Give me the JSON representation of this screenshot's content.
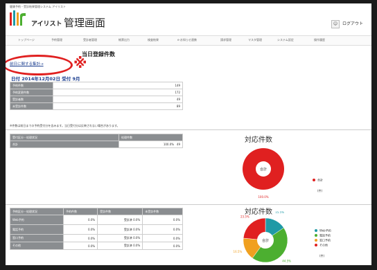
{
  "header": {
    "top_label": "健康予約・受診結果管理システム アイリスト",
    "brand": "アイリスト",
    "page_title": "管理画面",
    "user_icon": "person-icon",
    "logout_label": "ログアウト"
  },
  "nav": {
    "items": [
      "トップページ",
      "予約管理",
      "受診者管理",
      "帳票出力",
      "検査結果",
      "e-お知らせ連携",
      "請求管理",
      "マスタ管理",
      "システム設定",
      "操作履歴"
    ]
  },
  "today": {
    "title": "当日登録件数",
    "link": "前日に関する集計→",
    "mark": "※",
    "date": "日付 2014年12月02日 受付 9月"
  },
  "summary_table": {
    "rows": [
      {
        "label": "予約件数",
        "value": "149"
      },
      {
        "label": "予約変更件数",
        "value": "172"
      },
      {
        "label": "受診者数",
        "value": "49"
      },
      {
        "label": "未受診件数",
        "value": "89"
      }
    ]
  },
  "note": "※件数は前日までの予約受付分を含みます。当日受付分は反映されない場合があります。",
  "mid_table": {
    "headers": [
      "受付区分・処理状況",
      "処理件数"
    ],
    "row": {
      "label": "合計",
      "value": "100.0%",
      "count": "49"
    }
  },
  "bottom_table": {
    "headers": [
      "予約区分・処理状況",
      "予約件数",
      "受診件数",
      "未受診件数"
    ],
    "rows": [
      {
        "label": "Web予約",
        "c1": "Web予約",
        "c2": "0.0%",
        "c3": "受診済 0.0%",
        "c4": "0.0%"
      },
      {
        "label": "電話予約",
        "c1": "電話予約",
        "c2": "0.0%",
        "c3": "受診済 0.0%",
        "c4": "0.0%"
      },
      {
        "label": "窓口予約",
        "c1": "窓口予約",
        "c2": "0.0%",
        "c3": "受診済 0.0%",
        "c4": "0.0%"
      },
      {
        "label": "その他",
        "c1": "その他",
        "c2": "0.0%",
        "c3": "受診済 0.0%",
        "c4": "0.0%"
      }
    ]
  },
  "chart_data": [
    {
      "type": "pie",
      "title": "対応件数",
      "center_label": "合計",
      "categories": [
        "合計"
      ],
      "values": [
        100
      ],
      "labels": [
        "100.0%"
      ],
      "colors": [
        "#e02020"
      ],
      "donut": true,
      "legend_position": "right",
      "unit_note": "(件)"
    },
    {
      "type": "pie",
      "title": "対応件数",
      "center_label": "合計",
      "categories": [
        "Web予約",
        "電話予約",
        "窓口予約",
        "その他"
      ],
      "values": [
        15.5,
        44.5,
        16.5,
        23.5
      ],
      "labels": [
        "15.5%",
        "44.5%",
        "16.5%",
        "23.5%"
      ],
      "colors": [
        "#1f9aa6",
        "#4caf30",
        "#f0a020",
        "#e02020"
      ],
      "donut": true,
      "legend_position": "right",
      "unit_note": "(件)"
    }
  ]
}
